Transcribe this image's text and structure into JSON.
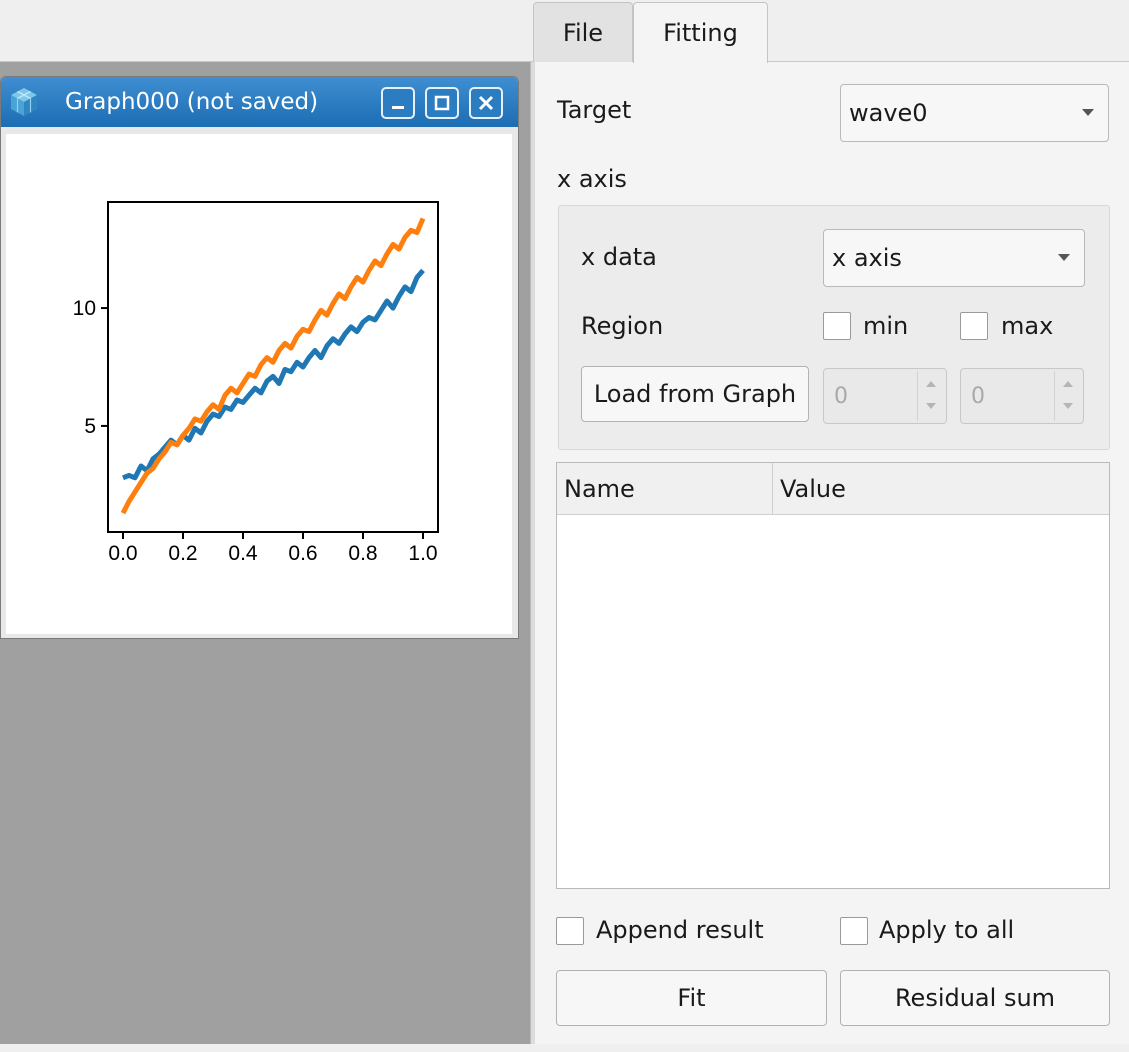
{
  "tabs": [
    {
      "label": "File",
      "selected": false
    },
    {
      "label": "Fitting",
      "selected": true
    }
  ],
  "graph_window": {
    "title": "Graph000 (not saved)",
    "icons": [
      "app-icon",
      "minimize-icon",
      "maximize-icon",
      "close-icon"
    ]
  },
  "chart_data": {
    "type": "line",
    "title": "",
    "xlabel": "",
    "ylabel": "",
    "xlim": [
      -0.05,
      1.05
    ],
    "ylim": [
      0.5,
      14.5
    ],
    "x_ticks": [
      "0.0",
      "0.2",
      "0.4",
      "0.6",
      "0.8",
      "1.0"
    ],
    "y_ticks": [
      "5",
      "10"
    ],
    "series": [
      {
        "color": "#1f77b4",
        "x": [
          0.0,
          0.02,
          0.04,
          0.06,
          0.08,
          0.1,
          0.12,
          0.14,
          0.16,
          0.18,
          0.2,
          0.22,
          0.24,
          0.26,
          0.28,
          0.3,
          0.32,
          0.34,
          0.36,
          0.38,
          0.4,
          0.42,
          0.44,
          0.46,
          0.48,
          0.5,
          0.52,
          0.54,
          0.56,
          0.58,
          0.6,
          0.62,
          0.64,
          0.66,
          0.68,
          0.7,
          0.72,
          0.74,
          0.76,
          0.78,
          0.8,
          0.82,
          0.84,
          0.86,
          0.88,
          0.9,
          0.92,
          0.94,
          0.96,
          0.98,
          1.0
        ],
        "y": [
          2.8,
          2.9,
          2.8,
          3.3,
          3.1,
          3.6,
          3.8,
          4.1,
          4.4,
          4.2,
          4.6,
          4.4,
          4.9,
          4.7,
          5.2,
          5.5,
          5.4,
          5.8,
          5.7,
          6.1,
          6.0,
          6.3,
          6.6,
          6.4,
          6.9,
          7.1,
          6.8,
          7.4,
          7.3,
          7.7,
          7.5,
          7.9,
          8.2,
          7.9,
          8.4,
          8.7,
          8.5,
          8.9,
          9.2,
          9.0,
          9.4,
          9.6,
          9.5,
          9.9,
          10.3,
          10.0,
          10.5,
          10.9,
          10.7,
          11.3,
          11.6
        ]
      },
      {
        "color": "#ff7f0e",
        "x": [
          0.0,
          0.02,
          0.04,
          0.06,
          0.08,
          0.1,
          0.12,
          0.14,
          0.16,
          0.18,
          0.2,
          0.22,
          0.24,
          0.26,
          0.28,
          0.3,
          0.32,
          0.34,
          0.36,
          0.38,
          0.4,
          0.42,
          0.44,
          0.46,
          0.48,
          0.5,
          0.52,
          0.54,
          0.56,
          0.58,
          0.6,
          0.62,
          0.64,
          0.66,
          0.68,
          0.7,
          0.72,
          0.74,
          0.76,
          0.78,
          0.8,
          0.82,
          0.84,
          0.86,
          0.88,
          0.9,
          0.92,
          0.94,
          0.96,
          0.98,
          1.0
        ],
        "y": [
          1.3,
          1.8,
          2.2,
          2.6,
          3.0,
          3.2,
          3.6,
          3.9,
          4.3,
          4.2,
          4.6,
          4.9,
          5.3,
          5.2,
          5.6,
          5.9,
          5.7,
          6.3,
          6.6,
          6.4,
          6.8,
          7.2,
          7.1,
          7.6,
          7.9,
          7.7,
          8.2,
          8.5,
          8.3,
          8.8,
          9.1,
          9.0,
          9.5,
          9.9,
          9.7,
          10.2,
          10.6,
          10.4,
          10.9,
          11.3,
          11.1,
          11.6,
          12.0,
          11.8,
          12.3,
          12.7,
          12.5,
          13.0,
          13.3,
          13.2,
          13.8
        ]
      }
    ],
    "grid": false,
    "legend": "none"
  },
  "fitting_panel": {
    "target_label": "Target",
    "target_value": "wave0",
    "x_axis_section_label": "x axis",
    "x_data_label": "x data",
    "x_data_value": "x axis",
    "region_label": "Region",
    "min_label": "min",
    "max_label": "max",
    "min_checked": false,
    "max_checked": false,
    "load_button": "Load from Graph",
    "min_value": "0",
    "max_value": "0",
    "table_columns": [
      "Name",
      "Value"
    ],
    "table_rows": [],
    "append_result_label": "Append result",
    "apply_to_all_label": "Apply to all",
    "append_result_checked": false,
    "apply_to_all_checked": false,
    "fit_button": "Fit",
    "residual_button": "Residual sum"
  }
}
